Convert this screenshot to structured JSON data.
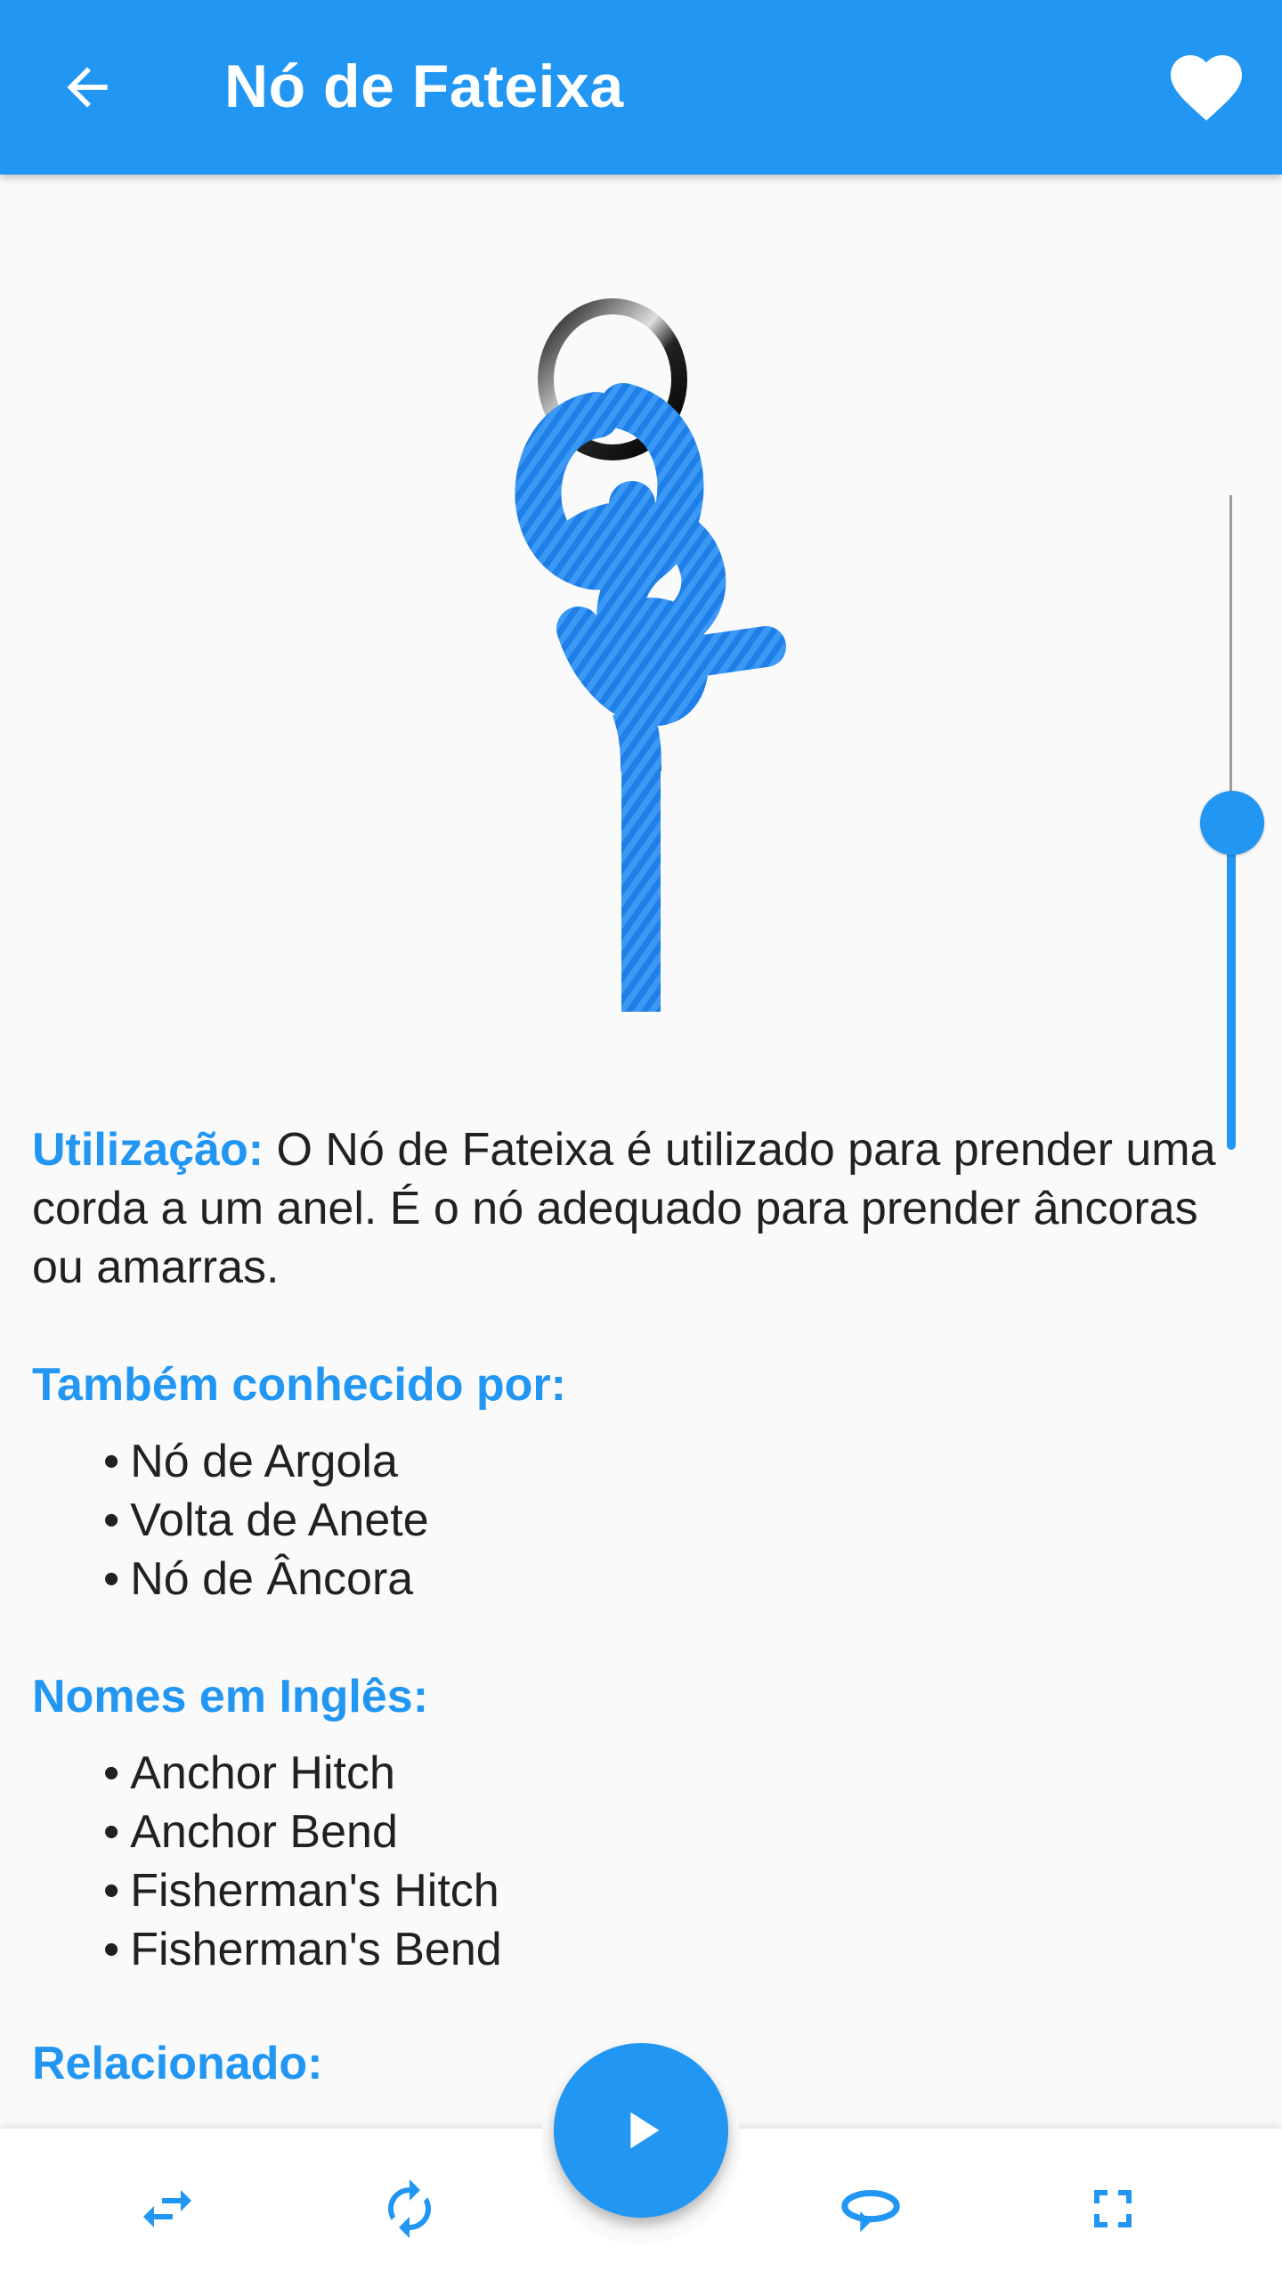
{
  "header": {
    "title": "Nó de Fateixa",
    "back_icon": "arrow-back-icon",
    "favorite_icon": "heart-icon"
  },
  "colors": {
    "primary": "#2196F3",
    "rope": "#1E7FE8",
    "background": "#FAFAFA"
  },
  "animation": {
    "image": "anchor-hitch-knot-on-ring",
    "progress_fraction": 0.5
  },
  "usage": {
    "label": "Utilização:",
    "text": " O Nó de Fateixa é utilizado para prender uma corda a um anel. É o nó adequado para prender âncoras ou amarras."
  },
  "also_known": {
    "heading": "Também conhecido por:",
    "items": [
      "Nó de Argola",
      "Volta de Anete",
      "Nó de Âncora"
    ]
  },
  "english_names": {
    "heading": "Nomes em Inglês:",
    "items": [
      "Anchor Hitch",
      "Anchor Bend",
      "Fisherman's Hitch",
      "Fisherman's Bend"
    ]
  },
  "related": {
    "heading": "Relacionado:"
  },
  "bottom_bar": {
    "play_icon": "play-icon",
    "buttons": [
      "swap-horizontal-icon",
      "rotate-icon",
      "loop-rotate-icon",
      "fullscreen-icon"
    ]
  }
}
